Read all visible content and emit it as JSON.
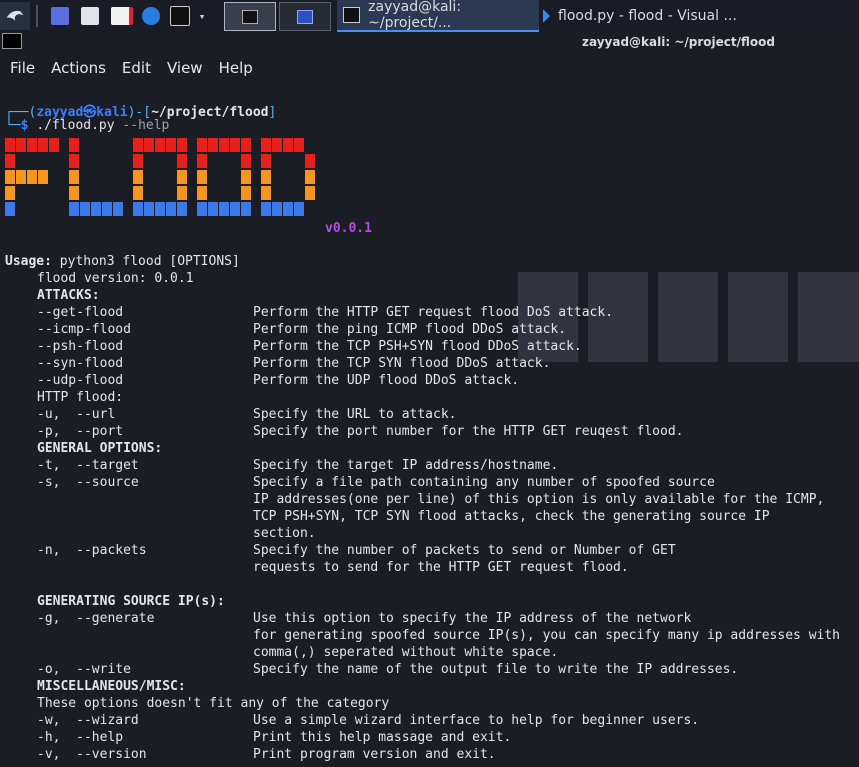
{
  "taskbar": {
    "tasks": [
      {
        "label": "zayyad@kali: ~/project/..."
      },
      {
        "label": "flood.py - flood - Visual ..."
      }
    ]
  },
  "window": {
    "title": "zayyad@kali: ~/project/flood"
  },
  "menu": [
    "File",
    "Actions",
    "Edit",
    "View",
    "Help"
  ],
  "prompt": {
    "user": "zayyad",
    "host": "kali",
    "path": "~/project/flood",
    "command": "./flood.py",
    "args": "--help"
  },
  "banner": {
    "word": "FLOOD",
    "version": "v0.0.1",
    "colors": {
      "top": "#e8201c",
      "mid": "#f7961e",
      "bottom": "#3b7ae8"
    }
  },
  "help": {
    "usage_label": "Usage:",
    "usage": " python3 flood [OPTIONS]",
    "version_line": "flood version: 0.0.1",
    "sections": [
      {
        "heading": "ATTACKS:",
        "bold": true,
        "options": [
          {
            "flag": "--get-flood",
            "desc": [
              "Perform the HTTP GET request flood DoS attack."
            ]
          },
          {
            "flag": "--icmp-flood",
            "desc": [
              "Perform the ping ICMP flood DDoS attack."
            ]
          },
          {
            "flag": "--psh-flood",
            "desc": [
              "Perform the TCP PSH+SYN flood DDoS attack."
            ]
          },
          {
            "flag": "--syn-flood",
            "desc": [
              "Perform the TCP SYN flood DDoS attack."
            ]
          },
          {
            "flag": "--udp-flood",
            "desc": [
              "Perform the UDP flood DDoS attack."
            ]
          }
        ]
      },
      {
        "heading": "HTTP flood:",
        "bold": false,
        "options": [
          {
            "flag": "-u,  --url",
            "desc": [
              "Specify the URL to attack."
            ]
          },
          {
            "flag": "-p,  --port",
            "desc": [
              "Specify the port number for the HTTP GET reuqest flood."
            ]
          }
        ]
      },
      {
        "heading": "GENERAL OPTIONS:",
        "bold": true,
        "options": [
          {
            "flag": "-t,  --target",
            "desc": [
              "Specify the target IP address/hostname."
            ]
          },
          {
            "flag": "-s,  --source",
            "desc": [
              "Specify a file path containing any number of spoofed source",
              "IP addresses(one per line) of this option is only available for the ICMP,",
              "TCP PSH+SYN, TCP SYN flood attacks, check the generating source IP",
              "section."
            ]
          },
          {
            "flag": "-n,  --packets",
            "desc": [
              "Specify the number of packets to send or Number of GET",
              "requests to send for the HTTP GET request flood."
            ]
          }
        ]
      },
      {
        "heading": "GENERATING SOURCE IP(s):",
        "bold": true,
        "gap_before": true,
        "options": [
          {
            "flag": "-g,  --generate",
            "desc": [
              "Use this option to specify the IP address of the network",
              "for generating spoofed source IP(s), you can specify many ip addresses with",
              "comma(,) seperated without white space."
            ]
          },
          {
            "flag": "-o,  --write",
            "desc": [
              "Specify the name of the output file to write the IP addresses."
            ]
          }
        ]
      },
      {
        "heading": "MISCELLANEOUS/MISC:",
        "bold": true,
        "note": "These options doesn't fit any of the category",
        "options": [
          {
            "flag": "-w,  --wizard",
            "desc": [
              "Use a simple wizard interface to help for beginner users."
            ]
          },
          {
            "flag": "-h,  --help",
            "desc": [
              "Print this help massage and exit."
            ]
          },
          {
            "flag": "-v,  --version",
            "desc": [
              "Print program version and exit."
            ]
          }
        ]
      }
    ]
  }
}
